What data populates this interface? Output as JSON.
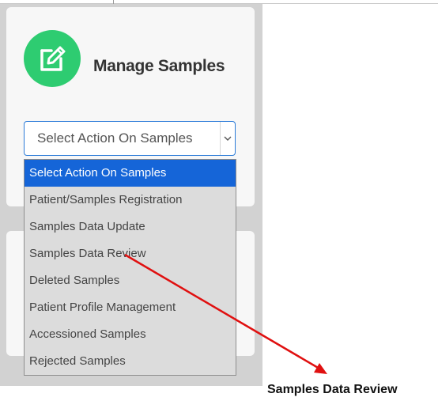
{
  "card": {
    "title": "Manage Samples",
    "icon": "edit-icon"
  },
  "select": {
    "value": "Select Action On Samples",
    "arrow_icon": "chevron-down-icon"
  },
  "dropdown": {
    "options": [
      "Select Action On Samples",
      "Patient/Samples Registration",
      "Samples Data Update",
      "Samples Data Review",
      "Deleted Samples",
      "Patient Profile Management",
      "Accessioned Samples",
      "Rejected Samples"
    ],
    "selected_index": 0
  },
  "annotation": {
    "label": "Samples Data Review",
    "color": "#e01010"
  },
  "colors": {
    "accent": "#2ecc71",
    "selected": "#1565d8"
  }
}
